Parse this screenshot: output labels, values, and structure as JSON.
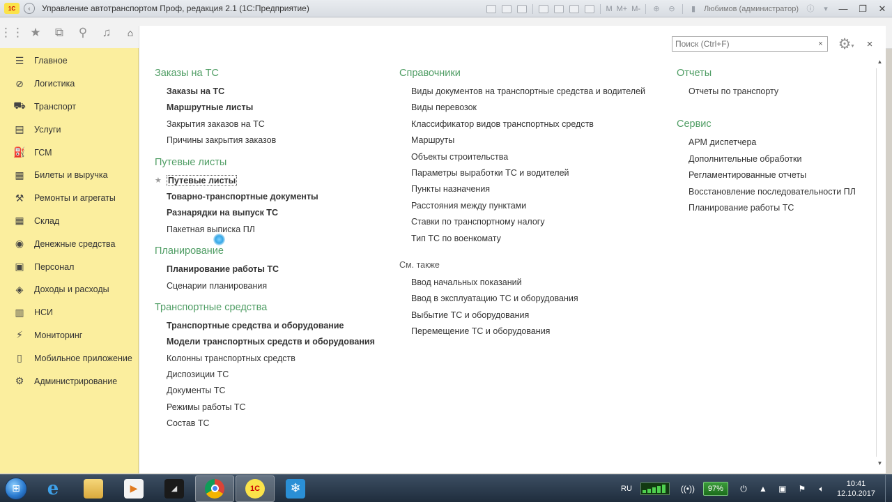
{
  "window": {
    "title": "Управление автотранспортом Проф, редакция 2.1  (1С:Предприятие)",
    "user": "Любимов (администратор)",
    "m_buttons": [
      "M",
      "M+",
      "M-"
    ]
  },
  "search": {
    "placeholder": "Поиск (Ctrl+F)"
  },
  "sidebar": {
    "items": [
      {
        "label": "Главное",
        "icon": "menu-icon"
      },
      {
        "label": "Логистика",
        "icon": "compass-icon"
      },
      {
        "label": "Транспорт",
        "icon": "truck-icon"
      },
      {
        "label": "Услуги",
        "icon": "services-icon"
      },
      {
        "label": "ГСМ",
        "icon": "fuel-icon"
      },
      {
        "label": "Билеты и выручка",
        "icon": "ticket-icon"
      },
      {
        "label": "Ремонты и агрегаты",
        "icon": "wrench-icon"
      },
      {
        "label": "Склад",
        "icon": "warehouse-icon"
      },
      {
        "label": "Денежные средства",
        "icon": "money-icon"
      },
      {
        "label": "Персонал",
        "icon": "person-icon"
      },
      {
        "label": "Доходы и расходы",
        "icon": "income-icon"
      },
      {
        "label": "НСИ",
        "icon": "reference-icon"
      },
      {
        "label": "Мониторинг",
        "icon": "monitoring-icon"
      },
      {
        "label": "Мобильное приложение",
        "icon": "mobile-icon"
      },
      {
        "label": "Администрирование",
        "icon": "gear-icon"
      }
    ]
  },
  "content": {
    "col1": [
      {
        "title": "Заказы на ТС",
        "items": [
          {
            "label": "Заказы на ТС",
            "bold": true
          },
          {
            "label": "Маршрутные листы",
            "bold": true
          },
          {
            "label": "Закрытия заказов на ТС",
            "bold": false
          },
          {
            "label": "Причины закрытия заказов",
            "bold": false
          }
        ]
      },
      {
        "title": "Путевые листы",
        "items": [
          {
            "label": "Путевые листы",
            "bold": true
          },
          {
            "label": "Товарно-транспортные документы",
            "bold": true
          },
          {
            "label": "Разнарядки на выпуск ТС",
            "bold": true
          },
          {
            "label": "Пакетная выписка ПЛ",
            "bold": false
          }
        ]
      },
      {
        "title": "Планирование",
        "items": [
          {
            "label": "Планирование работы ТС",
            "bold": true
          },
          {
            "label": "Сценарии планирования",
            "bold": false
          }
        ]
      },
      {
        "title": "Транспортные средства",
        "items": [
          {
            "label": "Транспортные средства и оборудование",
            "bold": true
          },
          {
            "label": "Модели транспортных средств и оборудования",
            "bold": true
          },
          {
            "label": "Колонны транспортных средств",
            "bold": false
          },
          {
            "label": "Диспозиции ТС",
            "bold": false
          },
          {
            "label": "Документы ТС",
            "bold": false
          },
          {
            "label": "Режимы работы ТС",
            "bold": false
          },
          {
            "label": "Состав ТС",
            "bold": false
          }
        ]
      }
    ],
    "col2": {
      "title": "Справочники",
      "items": [
        "Виды документов на транспортные средства и водителей",
        "Виды перевозок",
        "Классификатор видов транспортных средств",
        "Маршруты",
        "Объекты строительства",
        "Параметры выработки ТС и водителей",
        "Пункты назначения",
        "Расстояния между пунктами",
        "Ставки по транспортному налогу",
        "Тип ТС по военкомату"
      ],
      "see_also_title": "См. также",
      "see_also": [
        "Ввод начальных показаний",
        "Ввод в эксплуатацию ТС и оборудования",
        "Выбытие ТС и оборудования",
        "Перемещение ТС и оборудования"
      ]
    },
    "col3": [
      {
        "title": "Отчеты",
        "items": [
          "Отчеты по транспорту"
        ]
      },
      {
        "title": "Сервис",
        "items": [
          "АРМ диспетчера",
          "Дополнительные обработки",
          "Регламентированные отчеты",
          "Восстановление последовательности ПЛ",
          "Планирование работы ТС"
        ]
      }
    ]
  },
  "taskbar": {
    "lang": "RU",
    "battery": "97%",
    "time": "10:41",
    "date": "12.10.2017"
  },
  "colors": {
    "sidebar_bg": "#fbee9e",
    "section_title": "#4f9d64",
    "taskbar_bg": "#2a3a4c"
  }
}
